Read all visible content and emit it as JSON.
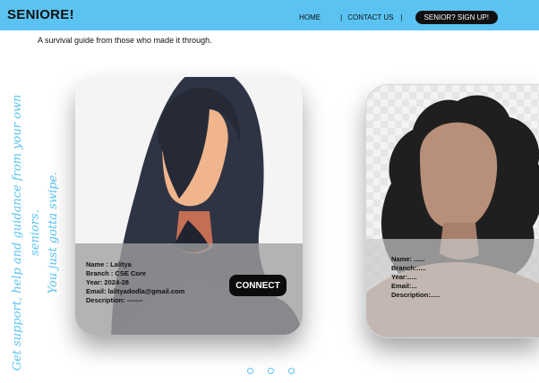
{
  "header": {
    "brand": "SENIORE!",
    "nav": {
      "home": "HOME",
      "contact": "CONTACT US",
      "separator": "|",
      "signup": "SENIOR? SIGN UP!"
    }
  },
  "tagline": "A survival guide from those who made it through.",
  "side_text": {
    "line1": "Get support, help and guidance from your own seniors.",
    "line2": "You just gotta swipe."
  },
  "cards": [
    {
      "name_line": "Name : Lalitya",
      "branch_line": "Branch : CSE Core",
      "year_line": "Year: 2024-28",
      "email_line": "Email: lalityadodla@gmail.com",
      "description_line": "Description: -------",
      "button": "CONNECT"
    },
    {
      "name_line": "Name: ......",
      "branch_line": "Branch:.....",
      "year_line": "Year:.....",
      "email_line": "Email:...",
      "description_line": "Description:....."
    }
  ],
  "colors": {
    "accent": "#5bc3f2",
    "button": "#0c0c0c",
    "text": "#111111"
  },
  "pagination": {
    "count": 3
  }
}
